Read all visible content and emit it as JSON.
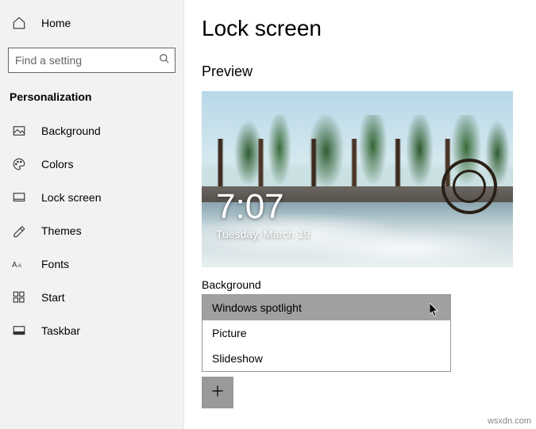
{
  "sidebar": {
    "home_label": "Home",
    "search_placeholder": "Find a setting",
    "category_label": "Personalization",
    "items": [
      {
        "label": "Background"
      },
      {
        "label": "Colors"
      },
      {
        "label": "Lock screen"
      },
      {
        "label": "Themes"
      },
      {
        "label": "Fonts"
      },
      {
        "label": "Start"
      },
      {
        "label": "Taskbar"
      }
    ]
  },
  "main": {
    "title": "Lock screen",
    "preview_label": "Preview",
    "clock_time": "7:07",
    "clock_date": "Tuesday, March 19",
    "background_label": "Background",
    "dropdown": {
      "options": [
        "Windows spotlight",
        "Picture",
        "Slideshow"
      ],
      "selected_index": 0
    }
  },
  "attribution": "wsxdn.com"
}
